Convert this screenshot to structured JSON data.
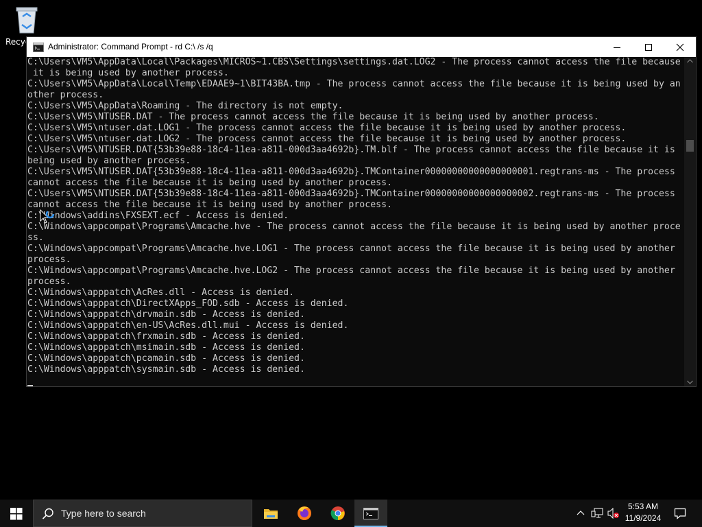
{
  "desktop": {
    "recycle_bin_label": "Recyc"
  },
  "window": {
    "title": "Administrator: Command Prompt - rd  C:\\ /s /q",
    "icon": "cmd-icon",
    "controls": [
      "minimize-icon",
      "maximize-icon",
      "close-icon"
    ]
  },
  "console": {
    "lines": [
      "C:\\Users\\VM5\\AppData\\Local\\Packages\\MICROS~1.CBS\\Settings\\settings.dat.LOG2 - The process cannot access the file because",
      " it is being used by another process.",
      "C:\\Users\\VM5\\AppData\\Local\\Temp\\EDAAE9~1\\BIT43BA.tmp - The process cannot access the file because it is being used by an",
      "other process.",
      "C:\\Users\\VM5\\AppData\\Roaming - The directory is not empty.",
      "C:\\Users\\VM5\\NTUSER.DAT - The process cannot access the file because it is being used by another process.",
      "C:\\Users\\VM5\\ntuser.dat.LOG1 - The process cannot access the file because it is being used by another process.",
      "C:\\Users\\VM5\\ntuser.dat.LOG2 - The process cannot access the file because it is being used by another process.",
      "C:\\Users\\VM5\\NTUSER.DAT{53b39e88-18c4-11ea-a811-000d3aa4692b}.TM.blf - The process cannot access the file because it is",
      "being used by another process.",
      "C:\\Users\\VM5\\NTUSER.DAT{53b39e88-18c4-11ea-a811-000d3aa4692b}.TMContainer00000000000000000001.regtrans-ms - The process",
      "cannot access the file because it is being used by another process.",
      "C:\\Users\\VM5\\NTUSER.DAT{53b39e88-18c4-11ea-a811-000d3aa4692b}.TMContainer00000000000000000002.regtrans-ms - The process",
      "cannot access the file because it is being used by another process.",
      "C:\\Windows\\addins\\FXSEXT.ecf - Access is denied.",
      "C:\\Windows\\appcompat\\Programs\\Amcache.hve - The process cannot access the file because it is being used by another proce",
      "ss.",
      "C:\\Windows\\appcompat\\Programs\\Amcache.hve.LOG1 - The process cannot access the file because it is being used by another",
      "process.",
      "C:\\Windows\\appcompat\\Programs\\Amcache.hve.LOG2 - The process cannot access the file because it is being used by another",
      "process.",
      "C:\\Windows\\apppatch\\AcRes.dll - Access is denied.",
      "C:\\Windows\\apppatch\\DirectXApps_FOD.sdb - Access is denied.",
      "C:\\Windows\\apppatch\\drvmain.sdb - Access is denied.",
      "C:\\Windows\\apppatch\\en-US\\AcRes.dll.mui - Access is denied.",
      "C:\\Windows\\apppatch\\frxmain.sdb - Access is denied.",
      "C:\\Windows\\apppatch\\msimain.sdb - Access is denied.",
      "C:\\Windows\\apppatch\\pcamain.sdb - Access is denied.",
      "C:\\Windows\\apppatch\\sysmain.sdb - Access is denied."
    ],
    "colors": {
      "background": "#0c0c0c",
      "text": "#cccccc"
    }
  },
  "taskbar": {
    "search_placeholder": "Type here to search",
    "apps": [
      "file-explorer-icon",
      "firefox-icon",
      "chrome-icon",
      "command-prompt-icon"
    ],
    "active_app": "command-prompt-icon",
    "tray": [
      "chevron-up-icon",
      "network-icon",
      "volume-muted-icon"
    ],
    "clock_time": "5:53 AM",
    "clock_date": "11/9/2024",
    "accent": "#76b9ed"
  }
}
